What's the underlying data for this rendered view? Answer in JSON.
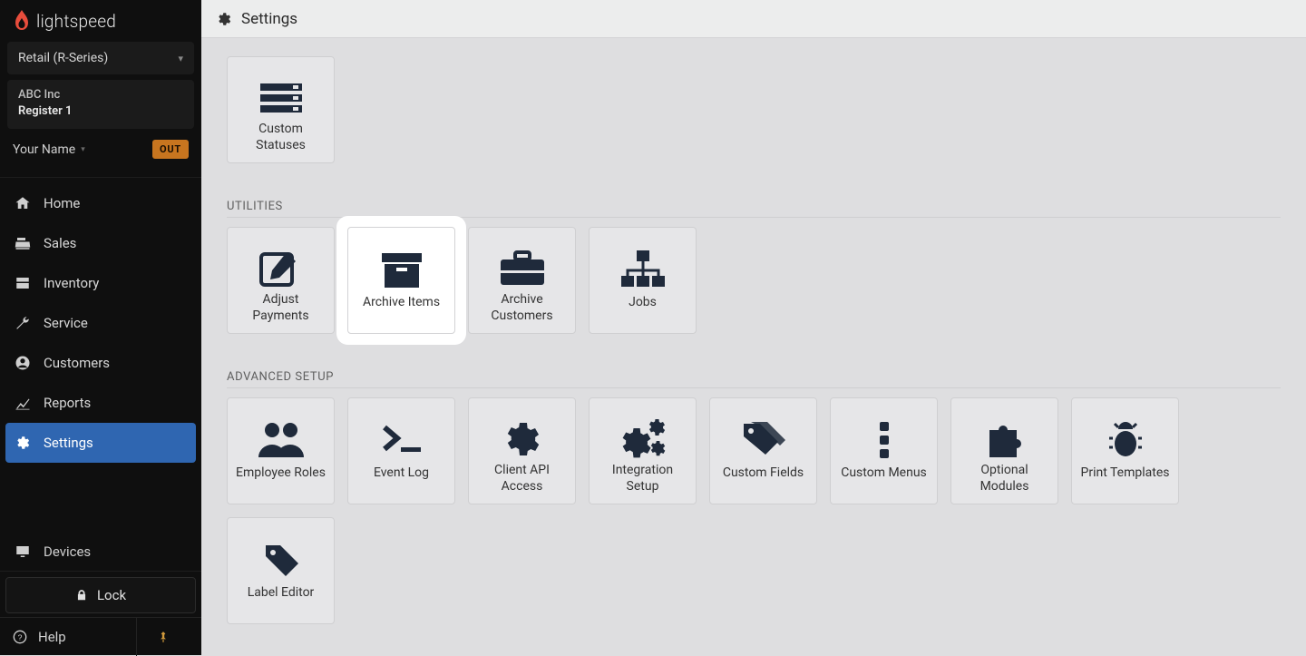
{
  "brand": "lightspeed",
  "product_selector": {
    "label": "Retail (R-Series)"
  },
  "account": {
    "company": "ABC Inc",
    "register": "Register 1"
  },
  "user": {
    "name": "Your Name",
    "status_badge": "OUT"
  },
  "nav": {
    "items": [
      {
        "key": "home",
        "label": "Home"
      },
      {
        "key": "sales",
        "label": "Sales"
      },
      {
        "key": "inventory",
        "label": "Inventory"
      },
      {
        "key": "service",
        "label": "Service"
      },
      {
        "key": "customers",
        "label": "Customers"
      },
      {
        "key": "reports",
        "label": "Reports"
      },
      {
        "key": "settings",
        "label": "Settings"
      }
    ],
    "active": "settings"
  },
  "devices": "Devices",
  "lock": "Lock",
  "help": "Help",
  "page": {
    "title": "Settings",
    "sections": {
      "top_tiles": [
        {
          "key": "custom-statuses",
          "label": "Custom Statuses"
        }
      ],
      "utilities": {
        "title": "UTILITIES",
        "tiles": [
          {
            "key": "adjust-payments",
            "label": "Adjust Payments"
          },
          {
            "key": "archive-items",
            "label": "Archive Items",
            "highlight": true
          },
          {
            "key": "archive-customers",
            "label": "Archive Customers"
          },
          {
            "key": "jobs",
            "label": "Jobs"
          }
        ]
      },
      "advanced": {
        "title": "ADVANCED SETUP",
        "tiles": [
          {
            "key": "employee-roles",
            "label": "Employee Roles"
          },
          {
            "key": "event-log",
            "label": "Event Log"
          },
          {
            "key": "client-api-access",
            "label": "Client API Access"
          },
          {
            "key": "integration-setup",
            "label": "Integration Setup"
          },
          {
            "key": "custom-fields",
            "label": "Custom Fields"
          },
          {
            "key": "custom-menus",
            "label": "Custom Menus"
          },
          {
            "key": "optional-modules",
            "label": "Optional Modules"
          },
          {
            "key": "print-templates",
            "label": "Print Templates"
          },
          {
            "key": "label-editor",
            "label": "Label Editor"
          }
        ]
      }
    }
  }
}
